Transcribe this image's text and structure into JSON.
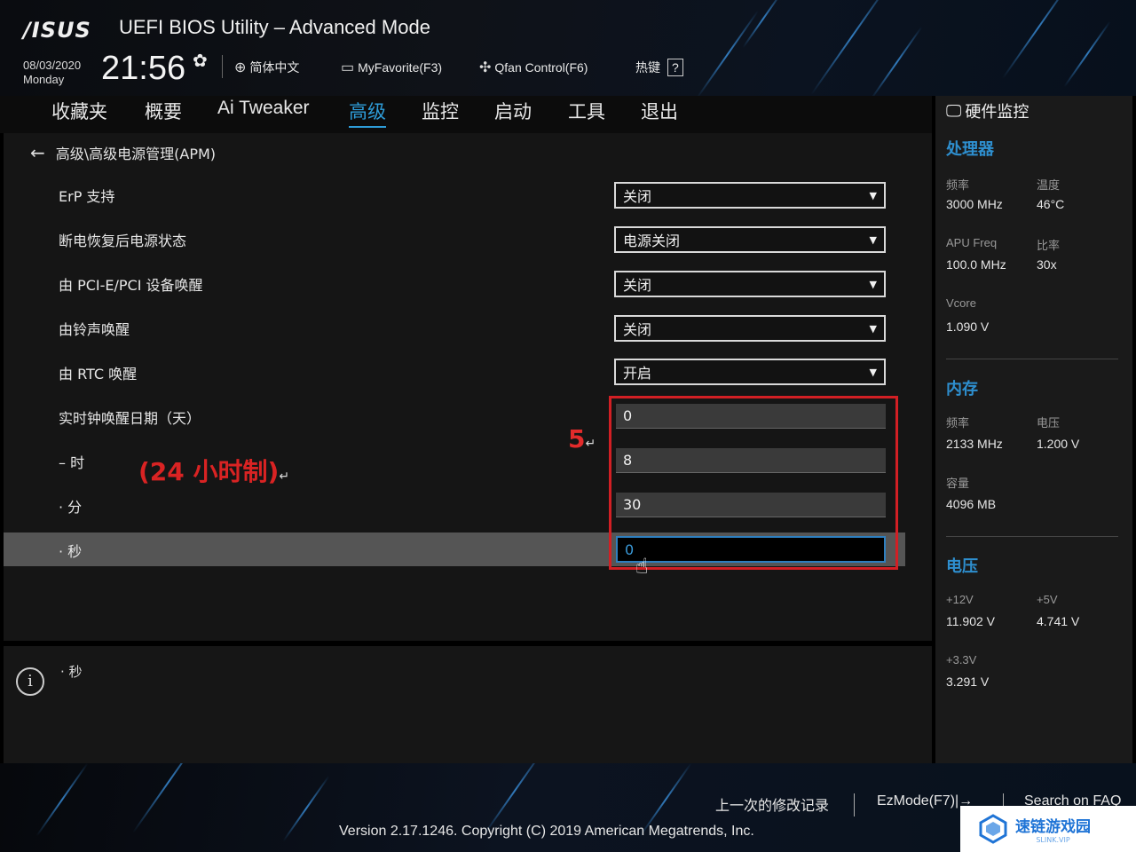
{
  "header": {
    "logo": "/ISUS",
    "title": "UEFI BIOS Utility – Advanced Mode",
    "date": "08/03/2020",
    "weekday": "Monday",
    "time": "21:56",
    "language": "简体中文",
    "myfavorite": "MyFavorite(F3)",
    "qfan": "Qfan Control(F6)",
    "hotkey_label": "热键",
    "hotkey_key": "?"
  },
  "nav": {
    "tabs": [
      "收藏夹",
      "概要",
      "Ai Tweaker",
      "高级",
      "监控",
      "启动",
      "工具",
      "退出"
    ],
    "active_index": 3
  },
  "main": {
    "breadcrumb": "高级\\高级电源管理(APM)",
    "rows": [
      {
        "label": "ErP 支持",
        "value": "关闭",
        "type": "dropdown"
      },
      {
        "label": "断电恢复后电源状态",
        "value": "电源关闭",
        "type": "dropdown"
      },
      {
        "label": "由 PCI-E/PCI 设备唤醒",
        "value": "关闭",
        "type": "dropdown"
      },
      {
        "label": "由铃声唤醒",
        "value": "关闭",
        "type": "dropdown"
      },
      {
        "label": "由 RTC 唤醒",
        "value": "开启",
        "type": "dropdown"
      },
      {
        "label": "实时钟唤醒日期（天）",
        "value": "0",
        "type": "input"
      },
      {
        "label": "– 时",
        "value": "8",
        "type": "input"
      },
      {
        "label": "· 分",
        "value": "30",
        "type": "input"
      },
      {
        "label": "· 秒",
        "value": "0",
        "type": "input",
        "selected": true
      }
    ]
  },
  "annotations": {
    "step": "5",
    "return_mark": "↵",
    "clock_note": "(24 小时制)"
  },
  "info": {
    "help_text": "· 秒"
  },
  "hw_monitor": {
    "title": "硬件监控",
    "cpu": {
      "heading": "处理器",
      "freq_label": "频率",
      "freq_value": "3000 MHz",
      "temp_label": "温度",
      "temp_value": "46°C",
      "apu_label": "APU Freq",
      "apu_value": "100.0 MHz",
      "ratio_label": "比率",
      "ratio_value": "30x",
      "vcore_label": "Vcore",
      "vcore_value": "1.090 V"
    },
    "memory": {
      "heading": "内存",
      "freq_label": "频率",
      "freq_value": "2133 MHz",
      "volt_label": "电压",
      "volt_value": "1.200 V",
      "cap_label": "容量",
      "cap_value": "4096 MB"
    },
    "voltage": {
      "heading": "电压",
      "v12_label": "+12V",
      "v12_value": "11.902 V",
      "v5_label": "+5V",
      "v5_value": "4.741 V",
      "v33_label": "+3.3V",
      "v33_value": "3.291 V"
    }
  },
  "footer": {
    "last_modified": "上一次的修改记录",
    "ezmode": "EzMode(F7)|→",
    "search": "Search on FAQ",
    "version": "Version 2.17.1246. Copyright (C) 2019 American Megatrends, Inc."
  },
  "watermark": {
    "main": "速链游戏园",
    "sub": "SLINK.VIP"
  },
  "colors": {
    "accent": "#2e9cd8",
    "annotation_red": "#d21f24",
    "hw_heading": "#2e8fcf"
  }
}
